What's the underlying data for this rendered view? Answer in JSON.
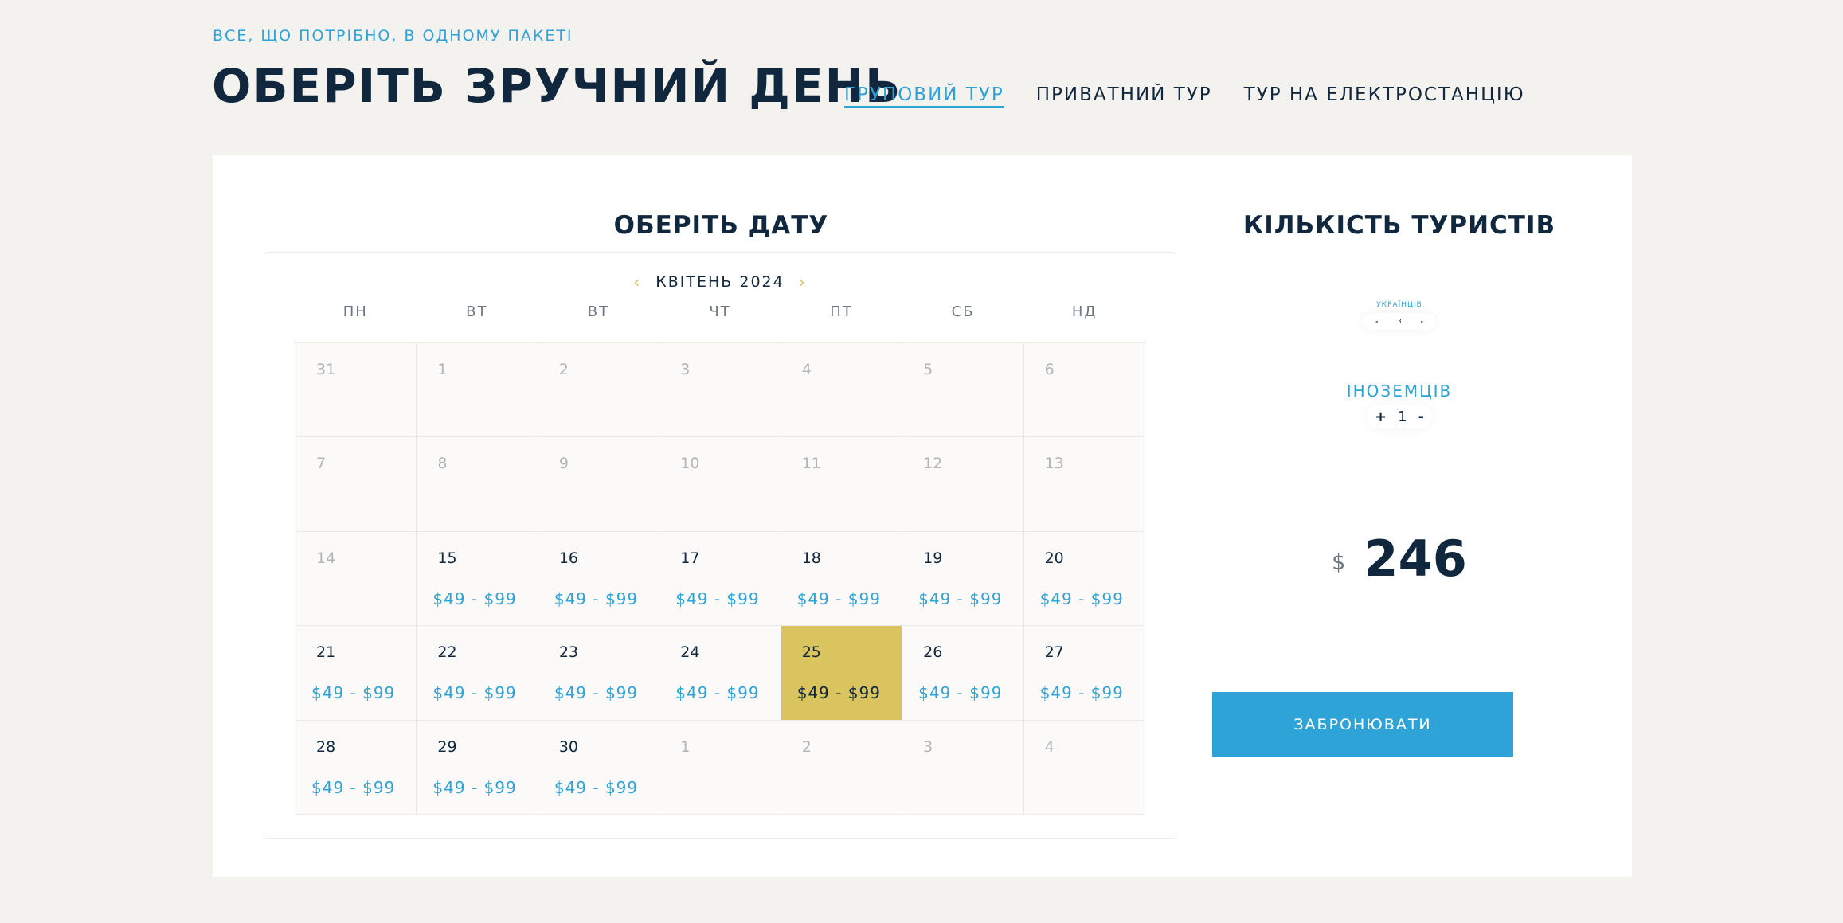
{
  "header": {
    "tagline": "ВСЕ, ЩО ПОТРІБНО, В ОДНОМУ ПАКЕТІ",
    "title": "ОБЕРІТЬ ЗРУЧНИЙ ДЕНЬ",
    "tabs": [
      {
        "label": "ГРУПОВИЙ ТУР",
        "active": true
      },
      {
        "label": "ПРИВАТНИЙ ТУР",
        "active": false
      },
      {
        "label": "ТУР НА ЕЛЕКТРОСТАНЦІЮ",
        "active": false
      }
    ]
  },
  "calendar": {
    "section_title": "ОБЕРІТЬ ДАТУ",
    "month_label": "КВІТЕНЬ 2024",
    "prev_arrow": "‹",
    "next_arrow": "›",
    "weekdays": [
      "ПН",
      "ВТ",
      "ВТ",
      "ЧТ",
      "ПТ",
      "СБ",
      "НД"
    ],
    "days": [
      {
        "day": "31",
        "price": "",
        "muted": true
      },
      {
        "day": "1",
        "price": "",
        "muted": true
      },
      {
        "day": "2",
        "price": "",
        "muted": true
      },
      {
        "day": "3",
        "price": "",
        "muted": true
      },
      {
        "day": "4",
        "price": "",
        "muted": true
      },
      {
        "day": "5",
        "price": "",
        "muted": true
      },
      {
        "day": "6",
        "price": "",
        "muted": true
      },
      {
        "day": "7",
        "price": "",
        "muted": true
      },
      {
        "day": "8",
        "price": "",
        "muted": true
      },
      {
        "day": "9",
        "price": "",
        "muted": true
      },
      {
        "day": "10",
        "price": "",
        "muted": true
      },
      {
        "day": "11",
        "price": "",
        "muted": true
      },
      {
        "day": "12",
        "price": "",
        "muted": true
      },
      {
        "day": "13",
        "price": "",
        "muted": true
      },
      {
        "day": "14",
        "price": "",
        "muted": true
      },
      {
        "day": "15",
        "price": "$49 - $99",
        "muted": false
      },
      {
        "day": "16",
        "price": "$49 - $99",
        "muted": false
      },
      {
        "day": "17",
        "price": "$49 - $99",
        "muted": false
      },
      {
        "day": "18",
        "price": "$49 - $99",
        "muted": false
      },
      {
        "day": "19",
        "price": "$49 - $99",
        "muted": false
      },
      {
        "day": "20",
        "price": "$49 - $99",
        "muted": false
      },
      {
        "day": "21",
        "price": "$49 - $99",
        "muted": false
      },
      {
        "day": "22",
        "price": "$49 - $99",
        "muted": false
      },
      {
        "day": "23",
        "price": "$49 - $99",
        "muted": false
      },
      {
        "day": "24",
        "price": "$49 - $99",
        "muted": false
      },
      {
        "day": "25",
        "price": "$49 - $99",
        "muted": false,
        "selected": true
      },
      {
        "day": "26",
        "price": "$49 - $99",
        "muted": false
      },
      {
        "day": "27",
        "price": "$49 - $99",
        "muted": false
      },
      {
        "day": "28",
        "price": "$49 - $99",
        "muted": false
      },
      {
        "day": "29",
        "price": "$49 - $99",
        "muted": false
      },
      {
        "day": "30",
        "price": "$49 - $99",
        "muted": false
      },
      {
        "day": "1",
        "price": "",
        "muted": true
      },
      {
        "day": "2",
        "price": "",
        "muted": true
      },
      {
        "day": "3",
        "price": "",
        "muted": true
      },
      {
        "day": "4",
        "price": "",
        "muted": true
      }
    ]
  },
  "tourists": {
    "section_title": "КІЛЬКІСТЬ ТУРИСТІВ",
    "ukrainians": {
      "label": "УКРАЇНЦІВ",
      "minus": "-",
      "value": "3",
      "plus": "-"
    },
    "foreigners": {
      "label": "ІНОЗЕМЦІВ",
      "plus": "+",
      "value": "1",
      "minus": "-"
    }
  },
  "price": {
    "currency": "$",
    "total": "246"
  },
  "book_button": "ЗАБРОНЮВАТИ",
  "colors": {
    "accent": "#2ea3d8",
    "selected_day": "#d9c460",
    "text_dark": "#10273d"
  }
}
